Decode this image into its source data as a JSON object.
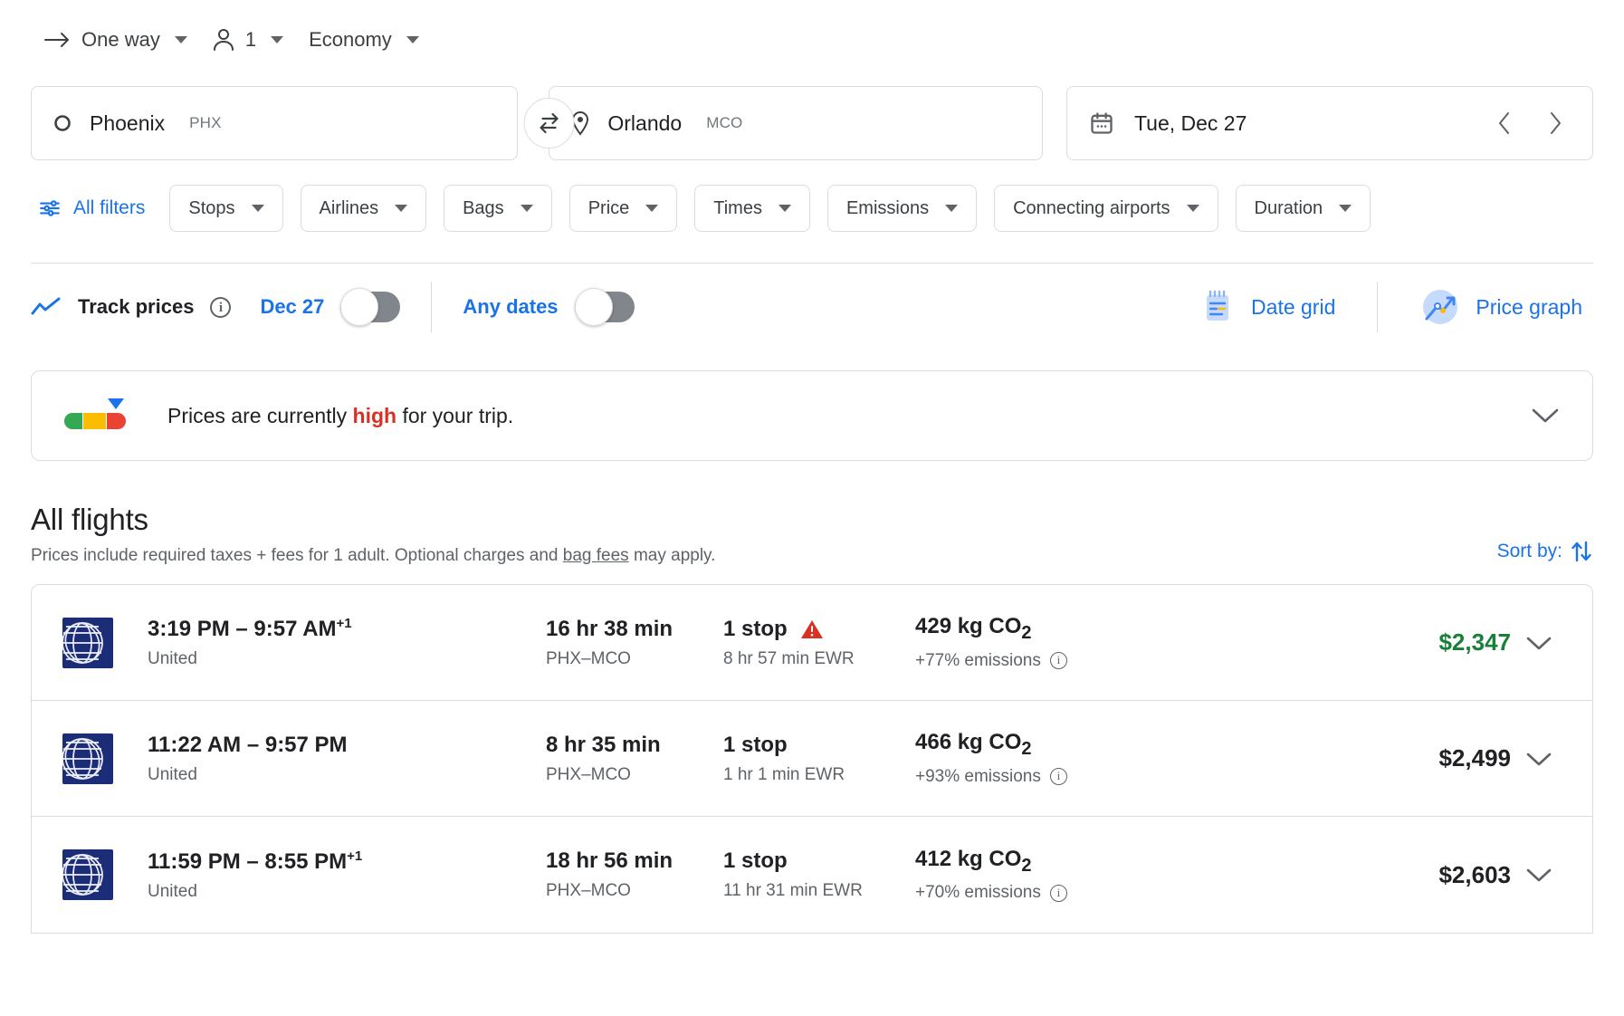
{
  "trip_options": {
    "trip_type": {
      "label": "One way",
      "icon": "arrow-right-icon"
    },
    "passengers": {
      "label": "1",
      "icon": "person-icon"
    },
    "cabin": {
      "label": "Economy"
    }
  },
  "search": {
    "origin": {
      "city": "Phoenix",
      "code": "PHX",
      "icon": "circle-icon"
    },
    "destination": {
      "city": "Orlando",
      "code": "MCO",
      "icon": "location-pin-icon"
    },
    "swap_icon": "swap-icon",
    "date": {
      "value": "Tue, Dec 27",
      "icon": "calendar-icon"
    }
  },
  "filters": {
    "all_filters": "All filters",
    "chips": [
      "Stops",
      "Airlines",
      "Bags",
      "Price",
      "Times",
      "Emissions",
      "Connecting airports",
      "Duration"
    ]
  },
  "track": {
    "label": "Track prices",
    "date_toggle_label": "Dec 27",
    "any_dates_label": "Any dates",
    "date_grid": "Date grid",
    "price_graph": "Price graph"
  },
  "insight": {
    "prefix": "Prices are currently ",
    "emphasis": "high",
    "suffix": " for your trip."
  },
  "all_flights": {
    "title": "All flights",
    "subtitle_before": "Prices include required taxes + fees for 1 adult. Optional charges and ",
    "subtitle_link": "bag fees",
    "subtitle_after": " may apply.",
    "sort_by": "Sort by:"
  },
  "flights": [
    {
      "airline": "United",
      "times": "3:19 PM – 9:57 AM",
      "day_offset": "+1",
      "duration": "16 hr 38 min",
      "route": "PHX–MCO",
      "stops": "1 stop",
      "warning": true,
      "layover": "8 hr 57 min EWR",
      "co2": "429 kg CO",
      "co2_sub": "2",
      "emissions": "+77% emissions",
      "price": "$2,347",
      "price_good": true
    },
    {
      "airline": "United",
      "times": "11:22 AM – 9:57 PM",
      "day_offset": "",
      "duration": "8 hr 35 min",
      "route": "PHX–MCO",
      "stops": "1 stop",
      "warning": false,
      "layover": "1 hr 1 min EWR",
      "co2": "466 kg CO",
      "co2_sub": "2",
      "emissions": "+93% emissions",
      "price": "$2,499",
      "price_good": false
    },
    {
      "airline": "United",
      "times": "11:59 PM – 8:55 PM",
      "day_offset": "+1",
      "duration": "18 hr 56 min",
      "route": "PHX–MCO",
      "stops": "1 stop",
      "warning": false,
      "layover": "11 hr 31 min EWR",
      "co2": "412 kg CO",
      "co2_sub": "2",
      "emissions": "+70% emissions",
      "price": "$2,603",
      "price_good": false
    }
  ],
  "colors": {
    "blue": "#1a73e8",
    "green": "#188038",
    "red": "#d93025",
    "united_navy": "#1c2d77"
  }
}
